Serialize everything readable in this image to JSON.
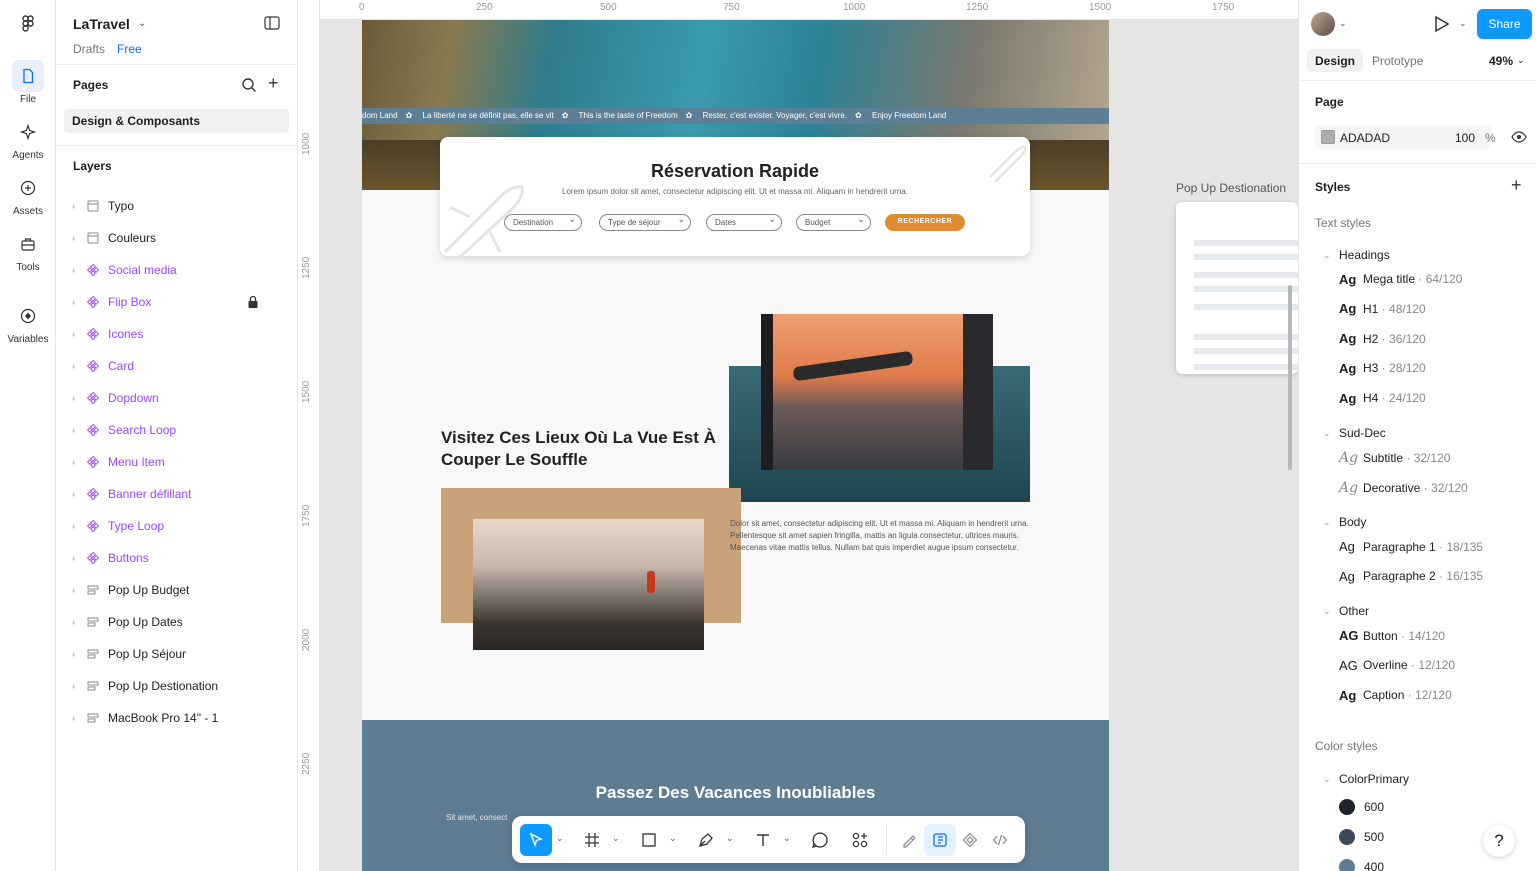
{
  "rail": {
    "items": [
      {
        "label": "File",
        "icon": "file-icon"
      },
      {
        "label": "Agents",
        "icon": "agents-icon"
      },
      {
        "label": "Assets",
        "icon": "assets-icon"
      },
      {
        "label": "Tools",
        "icon": "tools-icon"
      },
      {
        "label": "Variables",
        "icon": "variables-icon"
      }
    ]
  },
  "project": {
    "title": "LaTravel",
    "location": "Drafts",
    "plan": "Free"
  },
  "pages": {
    "heading": "Pages",
    "items": [
      {
        "label": "Design & Composants",
        "selected": true
      }
    ]
  },
  "layers": {
    "heading": "Layers",
    "items": [
      {
        "label": "Typo",
        "type": "section"
      },
      {
        "label": "Couleurs",
        "type": "section"
      },
      {
        "label": "Social media",
        "type": "component"
      },
      {
        "label": "Flip Box",
        "type": "component",
        "locked": true
      },
      {
        "label": "Icones",
        "type": "component"
      },
      {
        "label": "Card",
        "type": "component"
      },
      {
        "label": "Dopdown",
        "type": "component"
      },
      {
        "label": "Search Loop",
        "type": "component"
      },
      {
        "label": "Menu Item",
        "type": "component"
      },
      {
        "label": "Banner défillant",
        "type": "component"
      },
      {
        "label": "Type Loop",
        "type": "component"
      },
      {
        "label": "Buttons",
        "type": "component"
      },
      {
        "label": "Pop Up Budget",
        "type": "frame"
      },
      {
        "label": "Pop Up Dates",
        "type": "frame"
      },
      {
        "label": "Pop Up Séjour",
        "type": "frame"
      },
      {
        "label": "Pop Up Destionation",
        "type": "frame"
      },
      {
        "label": "MacBook Pro 14\" - 1",
        "type": "frame"
      }
    ]
  },
  "canvas": {
    "ruler_h": [
      "0",
      "250",
      "500",
      "750",
      "1000",
      "1250",
      "1500",
      "1750"
    ],
    "ruler_v": [
      "1000",
      "1250",
      "1500",
      "1750",
      "2000",
      "2250"
    ],
    "ticker": [
      "dom Land",
      "La liberté ne se définit pas, elle se vit",
      "This is the taste of Freedom",
      "Rester, c'est exister. Voyager, c'est vivre.",
      "Enjoy Freedom Land"
    ],
    "booking": {
      "title": "Réservation Rapide",
      "subtitle": "Lorem ipsum dolor sit amet, consectetur adipiscing elit. Ut et massa mi. Aliquam in hendrerit urna.",
      "fields": [
        "Destination",
        "Type de séjour",
        "Dates",
        "Budget"
      ],
      "button": "RECHERCHER"
    },
    "section_title": "Visitez Ces Lieux Où La Vue Est À Couper Le Souffle",
    "paragraph": "Dolor sit amet, consectetur adipiscing elit. Ut et massa mi. Aliquam in hendrerit urna. Pellentesque sit amet sapien fringilla, mattis an ligula consectetur, ultrices mauris. Maecenas vitae mattis tellus. Nullam bat quis imperdiet augue ipsum consectetur.",
    "footer_title": "Passez Des Vacances Inoubliables",
    "footer_sub": "Sit amet, consect",
    "side_frame_label": "Pop Up Destionation"
  },
  "toolbar": {
    "tools": [
      "move-tool",
      "frame-tool",
      "shape-tool",
      "pen-tool",
      "text-tool",
      "comment-tool",
      "actions-tool",
      "draw-mode",
      "design-mode",
      "component-mode",
      "dev-mode"
    ]
  },
  "right": {
    "share_label": "Share",
    "tabs": [
      "Design",
      "Prototype"
    ],
    "zoom": "49%",
    "page_heading": "Page",
    "page_fill": {
      "hex": "ADADAD",
      "opacity": "100",
      "unit": "%",
      "color": "#ADADAD"
    },
    "styles_heading": "Styles",
    "text_styles_label": "Text styles",
    "groups": [
      {
        "label": "Headings",
        "items": [
          {
            "glyph": "Ag",
            "name": "Mega title",
            "meta": "64/120"
          },
          {
            "glyph": "Ag",
            "name": "H1",
            "meta": "48/120"
          },
          {
            "glyph": "Ag",
            "name": "H2",
            "meta": "36/120"
          },
          {
            "glyph": "Ag",
            "name": "H3",
            "meta": "28/120"
          },
          {
            "glyph": "Ag",
            "name": "H4",
            "meta": "24/120"
          }
        ]
      },
      {
        "label": "Sud-Dec",
        "items": [
          {
            "glyph": "Ag",
            "name": "Subtitle",
            "meta": "32/120"
          },
          {
            "glyph": "Ag",
            "name": "Decorative",
            "meta": "32/120"
          }
        ]
      },
      {
        "label": "Body",
        "items": [
          {
            "glyph": "Ag",
            "name": "Paragraphe 1",
            "meta": "18/135"
          },
          {
            "glyph": "Ag",
            "name": "Paragraphe 2",
            "meta": "16/135"
          }
        ]
      },
      {
        "label": "Other",
        "items": [
          {
            "glyph": "AG",
            "name": "Button",
            "meta": "14/120"
          },
          {
            "glyph": "AG",
            "name": "Overline",
            "meta": "12/120"
          },
          {
            "glyph": "Ag",
            "name": "Caption",
            "meta": "12/120"
          }
        ]
      }
    ],
    "color_styles_label": "Color styles",
    "color_group": "ColorPrimary",
    "colors": [
      {
        "name": "600",
        "hex": "#1f2227"
      },
      {
        "name": "500",
        "hex": "#3b4a57"
      },
      {
        "name": "400",
        "hex": "#5f7d92"
      }
    ],
    "help": "?"
  }
}
